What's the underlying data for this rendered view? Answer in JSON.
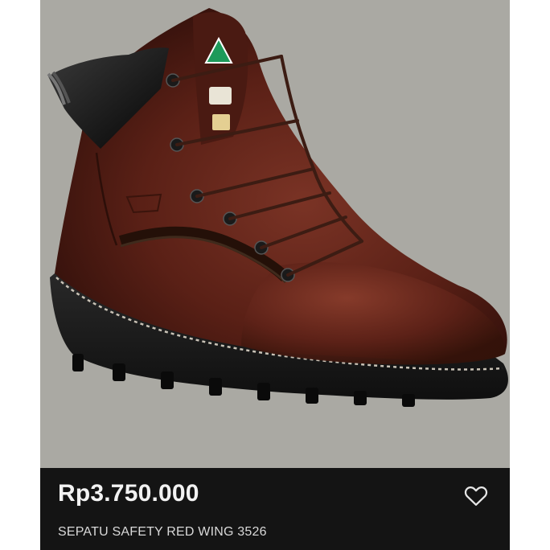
{
  "product": {
    "price": "Rp3.750.000",
    "title": "SEPATU SAFETY RED WING 3526",
    "image_subject": "brown-leather-safety-boot"
  },
  "icons": {
    "favorite": "heart-outline-icon"
  },
  "colors": {
    "info_background": "#141414",
    "photo_background": "#aaa9a3",
    "price_text": "#f2f2f2",
    "title_text": "#d9d9d9",
    "boot_leather": "#5a2016",
    "boot_sole": "#1c1c1c"
  }
}
